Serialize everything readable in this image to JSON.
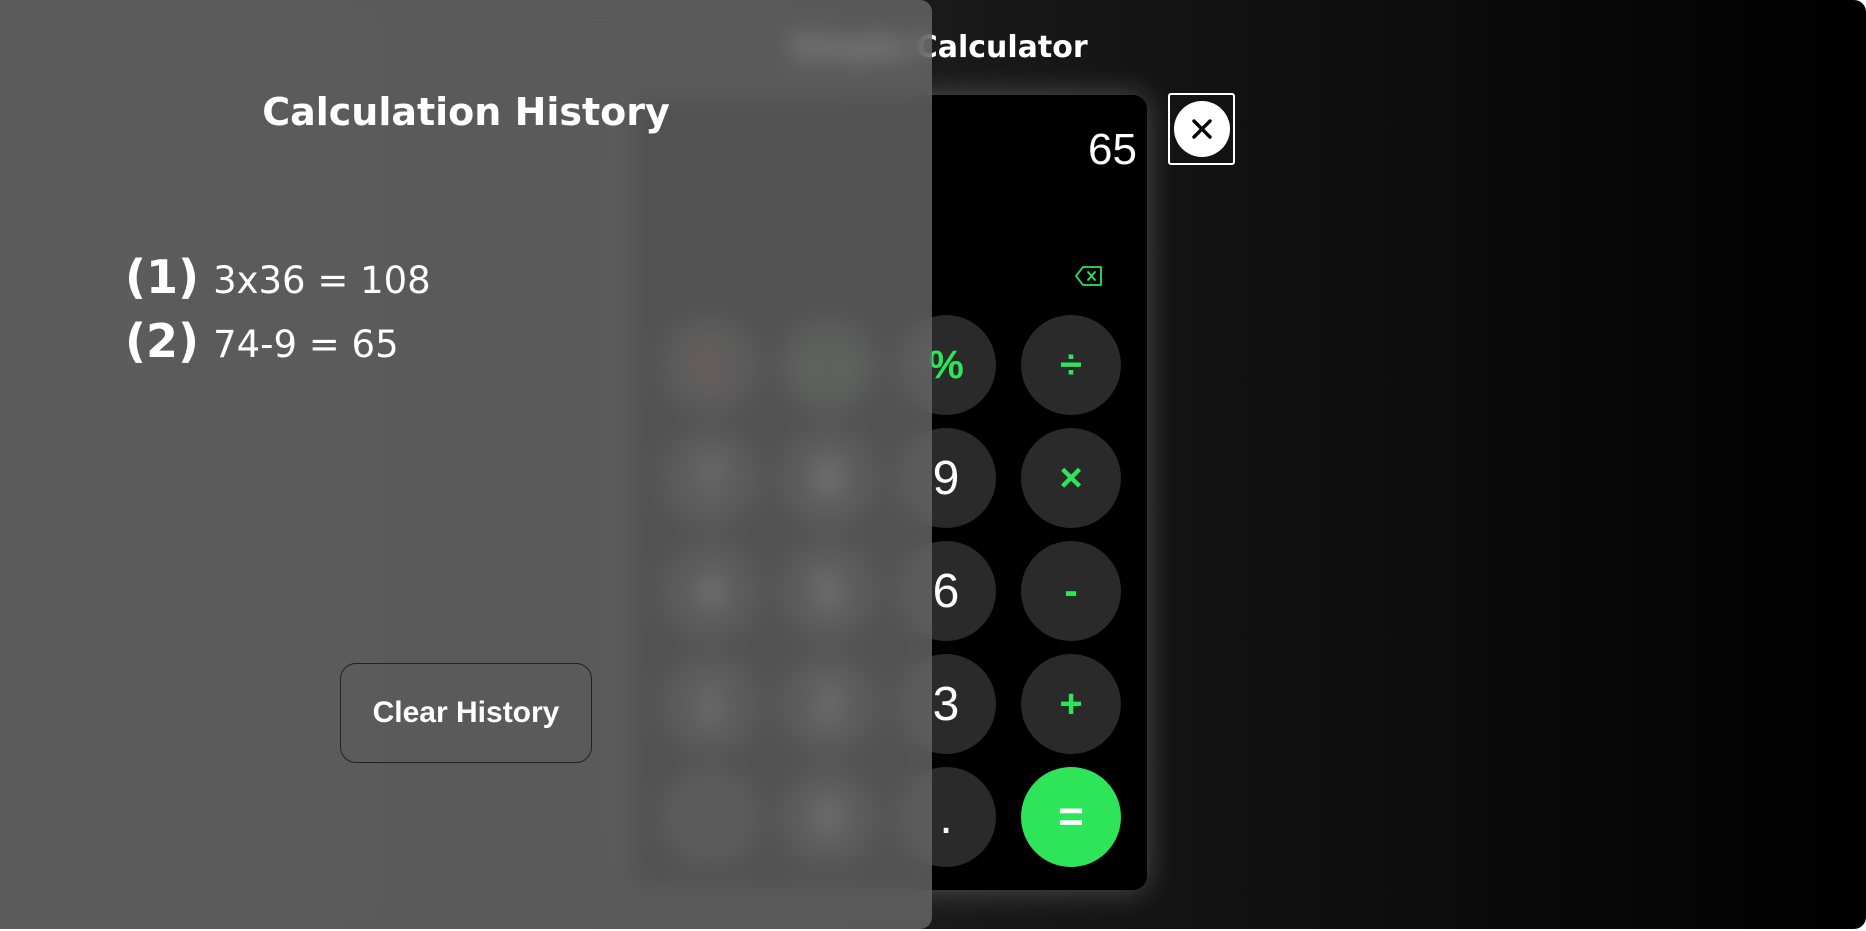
{
  "app": {
    "title": "Simple Calculator"
  },
  "calculator": {
    "display_value": "65",
    "backspace_icon": "backspace-icon",
    "keys": [
      {
        "name": "clear",
        "label": "C",
        "kind": "clear"
      },
      {
        "name": "plus-minus",
        "label": "( )",
        "kind": "paren"
      },
      {
        "name": "percent",
        "label": "%",
        "kind": "op"
      },
      {
        "name": "divide",
        "label": "÷",
        "kind": "op"
      },
      {
        "name": "seven",
        "label": "7",
        "kind": "num"
      },
      {
        "name": "eight",
        "label": "8",
        "kind": "num"
      },
      {
        "name": "nine",
        "label": "9",
        "kind": "num"
      },
      {
        "name": "multiply",
        "label": "×",
        "kind": "op"
      },
      {
        "name": "four",
        "label": "4",
        "kind": "num"
      },
      {
        "name": "five",
        "label": "5",
        "kind": "num"
      },
      {
        "name": "six",
        "label": "6",
        "kind": "num"
      },
      {
        "name": "subtract",
        "label": "-",
        "kind": "op"
      },
      {
        "name": "one",
        "label": "1",
        "kind": "num"
      },
      {
        "name": "two",
        "label": "2",
        "kind": "num"
      },
      {
        "name": "three",
        "label": "3",
        "kind": "num"
      },
      {
        "name": "add",
        "label": "+",
        "kind": "op"
      },
      {
        "name": "history",
        "label": "",
        "kind": "num"
      },
      {
        "name": "zero",
        "label": "0",
        "kind": "num"
      },
      {
        "name": "decimal",
        "label": ".",
        "kind": "num"
      },
      {
        "name": "equals",
        "label": "=",
        "kind": "eq"
      }
    ]
  },
  "history_panel": {
    "title": "Calculation History",
    "items": [
      {
        "index": "(1)",
        "expression": "3x36 = 108"
      },
      {
        "index": "(2)",
        "expression": "74-9 = 65"
      }
    ],
    "clear_label": "Clear History",
    "close_icon": "close-icon"
  },
  "colors": {
    "accent": "#2ee55a",
    "key_bg": "#2a2a2a",
    "clear_red": "#e53935"
  }
}
